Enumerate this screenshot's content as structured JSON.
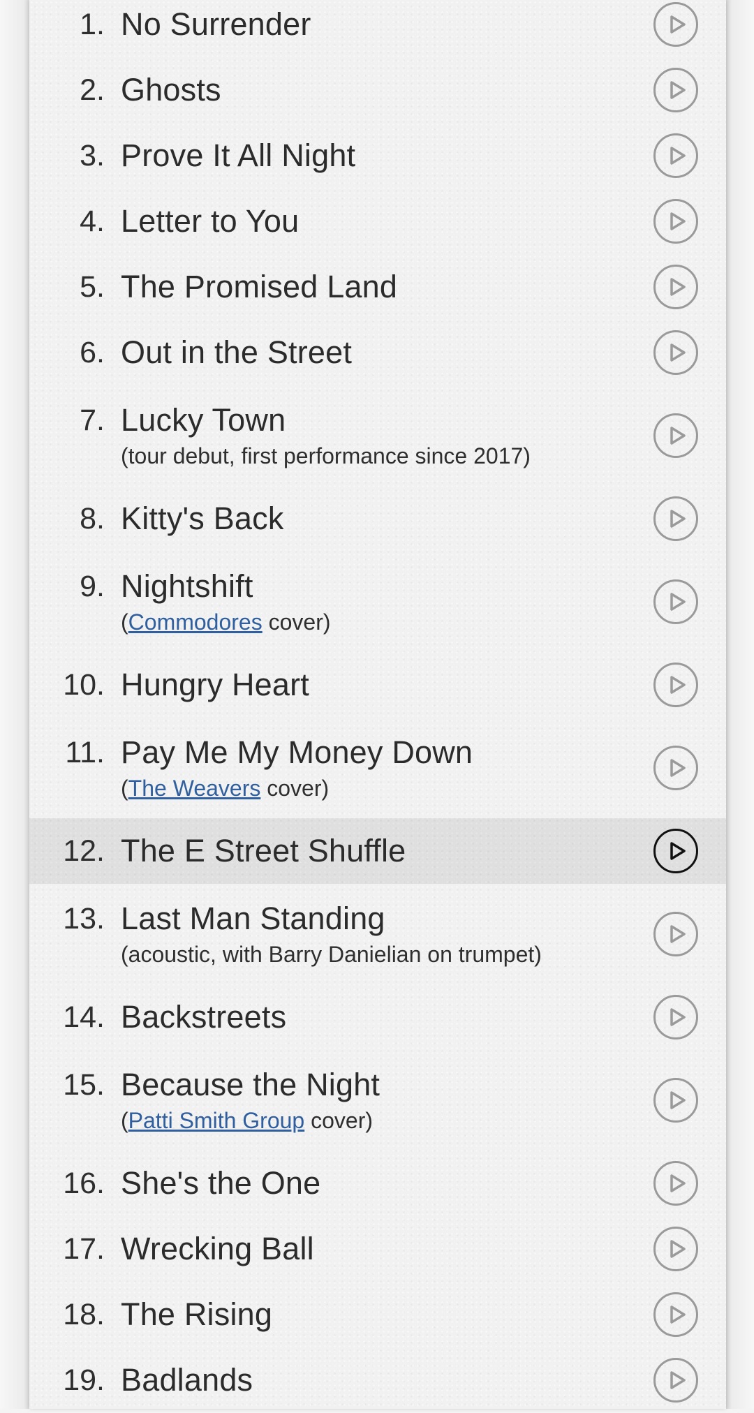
{
  "setlist": {
    "tracks": [
      {
        "number": "1.",
        "title": "No Surrender"
      },
      {
        "number": "2.",
        "title": "Ghosts"
      },
      {
        "number": "3.",
        "title": "Prove It All Night"
      },
      {
        "number": "4.",
        "title": "Letter to You"
      },
      {
        "number": "5.",
        "title": "The Promised Land"
      },
      {
        "number": "6.",
        "title": "Out in the Street"
      },
      {
        "number": "7.",
        "title": "Lucky Town",
        "note": "(tour debut, first performance since 2017)"
      },
      {
        "number": "8.",
        "title": "Kitty's Back"
      },
      {
        "number": "9.",
        "title": "Nightshift",
        "note_prefix": "(",
        "note_link": "Commodores",
        "note_suffix": " cover)"
      },
      {
        "number": "10.",
        "title": "Hungry Heart"
      },
      {
        "number": "11.",
        "title": "Pay Me My Money Down",
        "note_prefix": "(",
        "note_link": "The Weavers",
        "note_suffix": " cover)"
      },
      {
        "number": "12.",
        "title": "The E Street Shuffle",
        "current": true
      },
      {
        "number": "13.",
        "title": "Last Man Standing",
        "note": "(acoustic, with Barry Danielian on trumpet)"
      },
      {
        "number": "14.",
        "title": "Backstreets"
      },
      {
        "number": "15.",
        "title": "Because the Night",
        "note_prefix": "(",
        "note_link": "Patti Smith Group",
        "note_suffix": " cover)"
      },
      {
        "number": "16.",
        "title": "She's the One"
      },
      {
        "number": "17.",
        "title": "Wrecking Ball"
      },
      {
        "number": "18.",
        "title": "The Rising"
      },
      {
        "number": "19.",
        "title": "Badlands"
      }
    ],
    "play_icon": "play-circle-icon"
  },
  "colors": {
    "text": "#2b2b2b",
    "link": "#2f5f9e",
    "play_icon_idle": "#9a9a9a",
    "play_icon_active": "#111111",
    "highlight_row": "#e4e4e4",
    "background": "#f1f1f1"
  }
}
